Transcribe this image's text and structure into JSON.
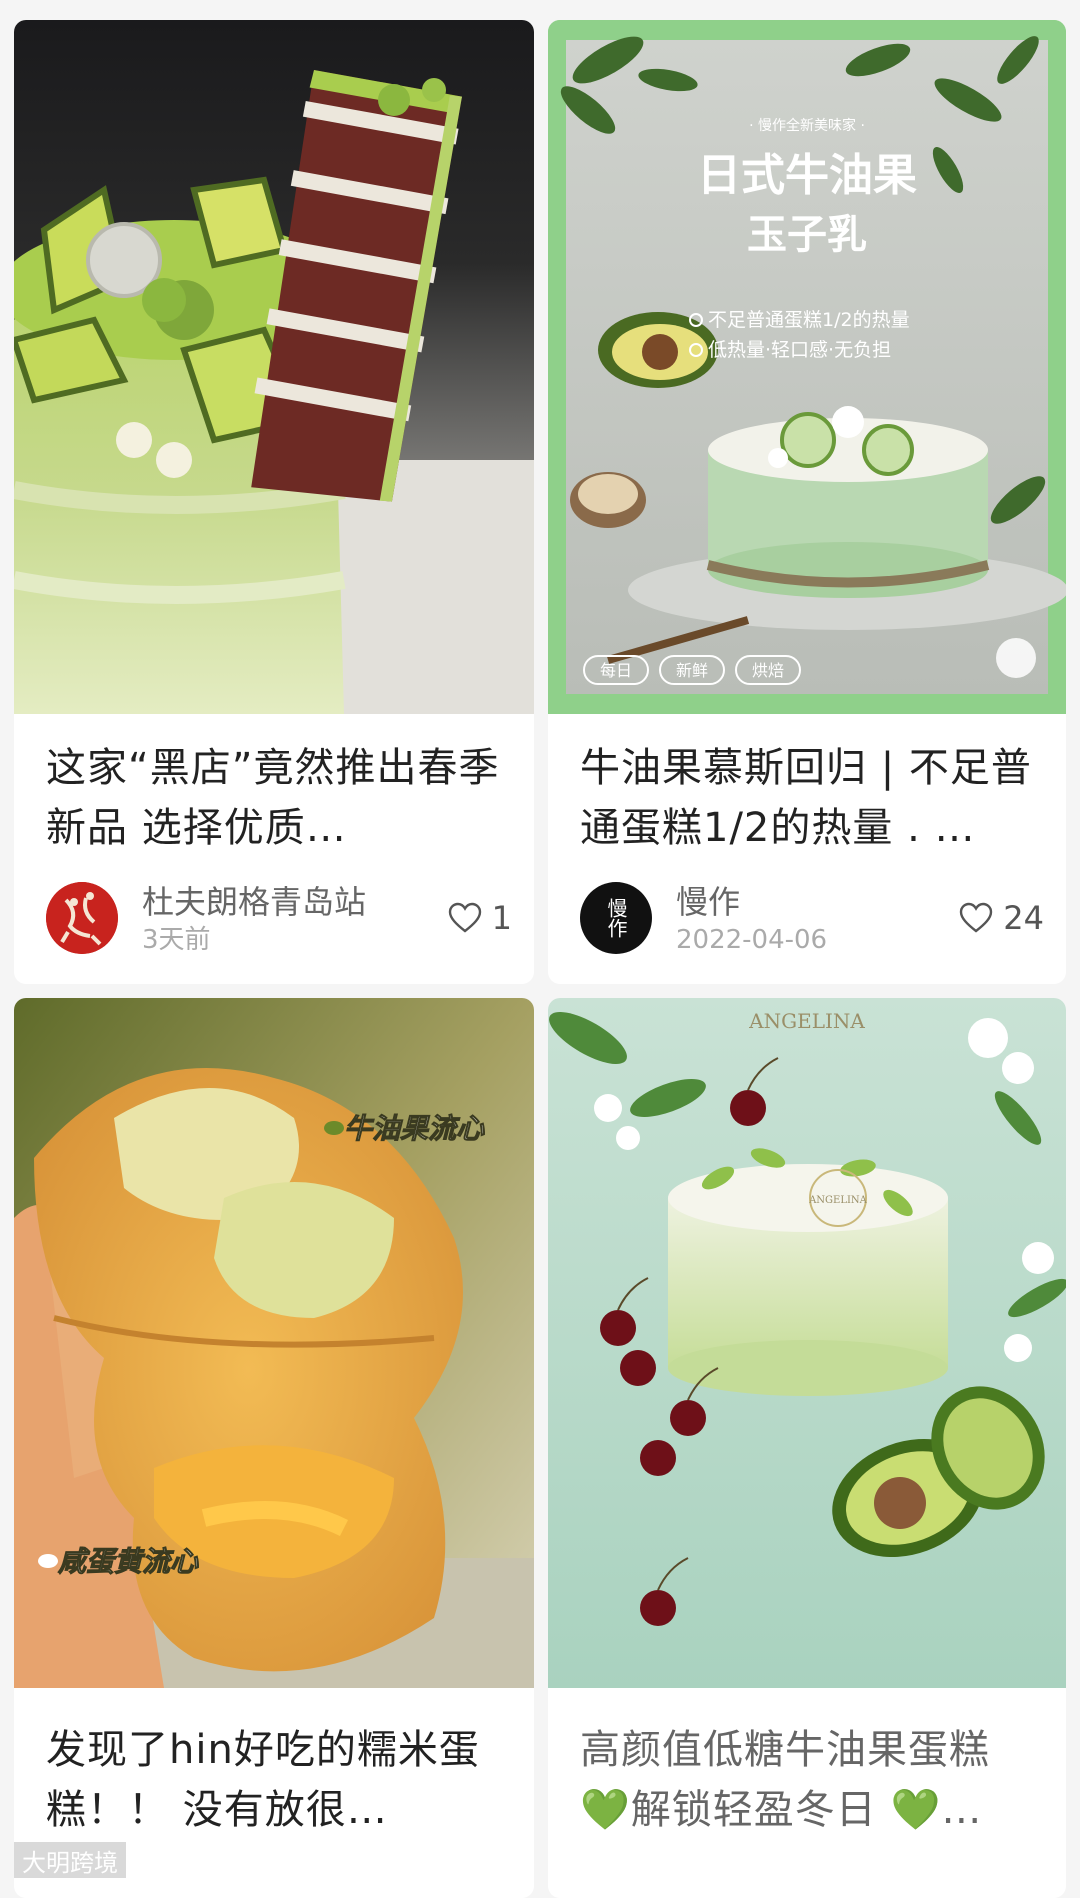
{
  "feed": {
    "cards": [
      {
        "title": "这家“黑店”竟然推出春季新品 选择优质…",
        "author": "杜夫朗格青岛站",
        "date": "3天前",
        "likes": "1"
      },
      {
        "title": "牛油果慕斯回归 | 不足普通蛋糕1/2的热量 . …",
        "image_text": {
          "brand_tag": "· 慢作全新美味家 ·",
          "headline_1": "日式牛油果",
          "headline_2": "玉子乳",
          "bullet_1": "不足普通蛋糕1/2的热量",
          "bullet_2": "低热量·轻口感·无负担",
          "badge_1": "每日",
          "badge_2": "新鲜",
          "badge_3": "烘焙"
        },
        "author": "慢作",
        "avatar_text": "慢作",
        "date": "2022-04-06",
        "likes": "24"
      },
      {
        "title": "发现了hin好吃的糯米蛋糕！！ 没有放很…",
        "image_text": {
          "label_1": "牛油果流心",
          "label_2": "咸蛋黄流心"
        }
      },
      {
        "title": "高颜值低糖牛油果蛋糕💚解锁轻盈冬日 💚…",
        "image_text": {
          "brand": "ANGELINA",
          "cake_brand": "ANGELINA"
        }
      }
    ]
  },
  "watermark": {
    "text": "大明跨境"
  },
  "colors": {
    "background": "#f5f5f5",
    "card": "#ffffff",
    "title": "#222222",
    "meta": "#666666",
    "avocado_green": "#a6cf6a",
    "mint_frame": "#8fd08a"
  }
}
